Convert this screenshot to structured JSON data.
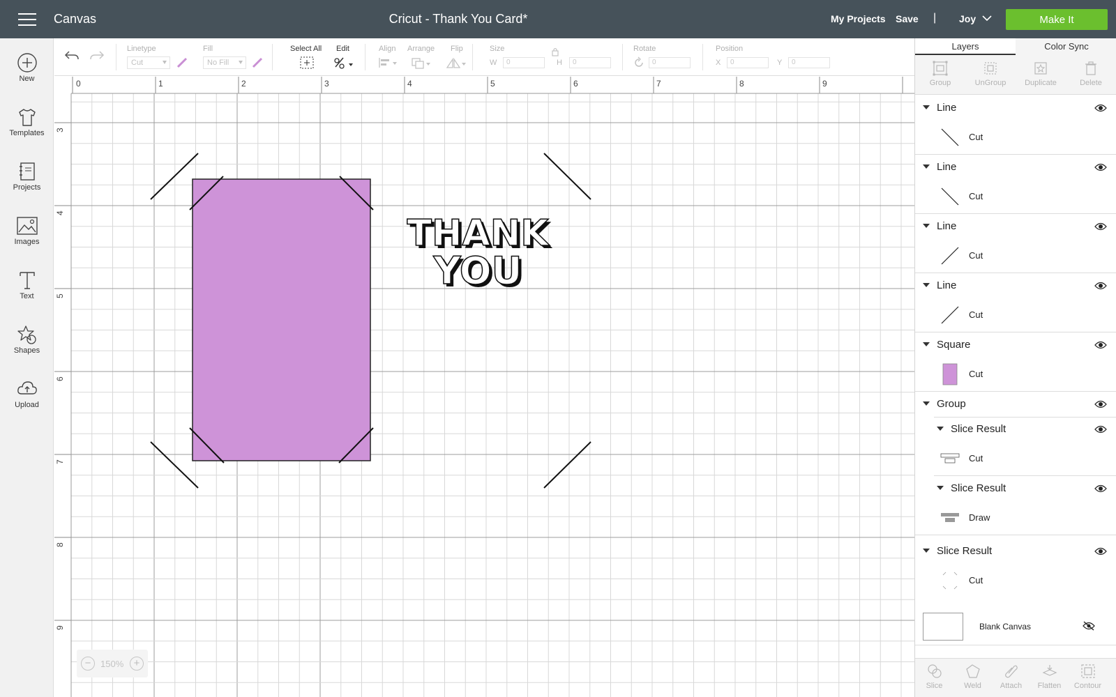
{
  "header": {
    "app_title": "Canvas",
    "doc_title": "Cricut - Thank You Card*",
    "my_projects": "My Projects",
    "save": "Save",
    "separator": "|",
    "user": "Joy",
    "make_it": "Make It"
  },
  "sidebar": {
    "items": [
      {
        "label": "New",
        "icon": "plus-circle-icon"
      },
      {
        "label": "Templates",
        "icon": "tshirt-icon"
      },
      {
        "label": "Projects",
        "icon": "notebook-icon"
      },
      {
        "label": "Images",
        "icon": "image-icon"
      },
      {
        "label": "Text",
        "icon": "text-icon"
      },
      {
        "label": "Shapes",
        "icon": "shapes-icon"
      },
      {
        "label": "Upload",
        "icon": "cloud-upload-icon"
      }
    ]
  },
  "toolbar": {
    "linetype_label": "Linetype",
    "linetype_value": "Cut",
    "fill_label": "Fill",
    "fill_value": "No Fill",
    "select_all": "Select All",
    "edit": "Edit",
    "align": "Align",
    "arrange": "Arrange",
    "flip": "Flip",
    "size": "Size",
    "w_label": "W",
    "w_value": "0",
    "h_label": "H",
    "h_value": "0",
    "rotate": "Rotate",
    "rotate_value": "0",
    "position": "Position",
    "x_label": "X",
    "x_value": "0",
    "y_label": "Y",
    "y_value": "0"
  },
  "canvas": {
    "ruler_top": [
      "0",
      "1",
      "2",
      "3",
      "4",
      "5",
      "6",
      "7",
      "8",
      "9"
    ],
    "ruler_left": [
      "3",
      "4",
      "5",
      "6",
      "7",
      "8",
      "9"
    ],
    "card_color": "#ce93d8",
    "text_line1": "THANK",
    "text_line2": "YOU",
    "zoom": "150%"
  },
  "panel": {
    "tabs": [
      "Layers",
      "Color Sync"
    ],
    "actions": [
      "Group",
      "UnGroup",
      "Duplicate",
      "Delete"
    ],
    "layers": [
      {
        "name": "Line",
        "op": "Cut",
        "thumb": "line-diag-down"
      },
      {
        "name": "Line",
        "op": "Cut",
        "thumb": "line-diag-down"
      },
      {
        "name": "Line",
        "op": "Cut",
        "thumb": "line-diag-up"
      },
      {
        "name": "Line",
        "op": "Cut",
        "thumb": "line-diag-up"
      },
      {
        "name": "Square",
        "op": "Cut",
        "thumb": "purple-square"
      }
    ],
    "group": {
      "name": "Group",
      "children": [
        {
          "name": "Slice Result",
          "op": "Cut"
        },
        {
          "name": "Slice Result",
          "op": "Draw"
        }
      ]
    },
    "slice_result": {
      "name": "Slice Result",
      "op": "Cut"
    },
    "blank_canvas": "Blank Canvas",
    "bottom_actions": [
      "Slice",
      "Weld",
      "Attach",
      "Flatten",
      "Contour"
    ]
  }
}
